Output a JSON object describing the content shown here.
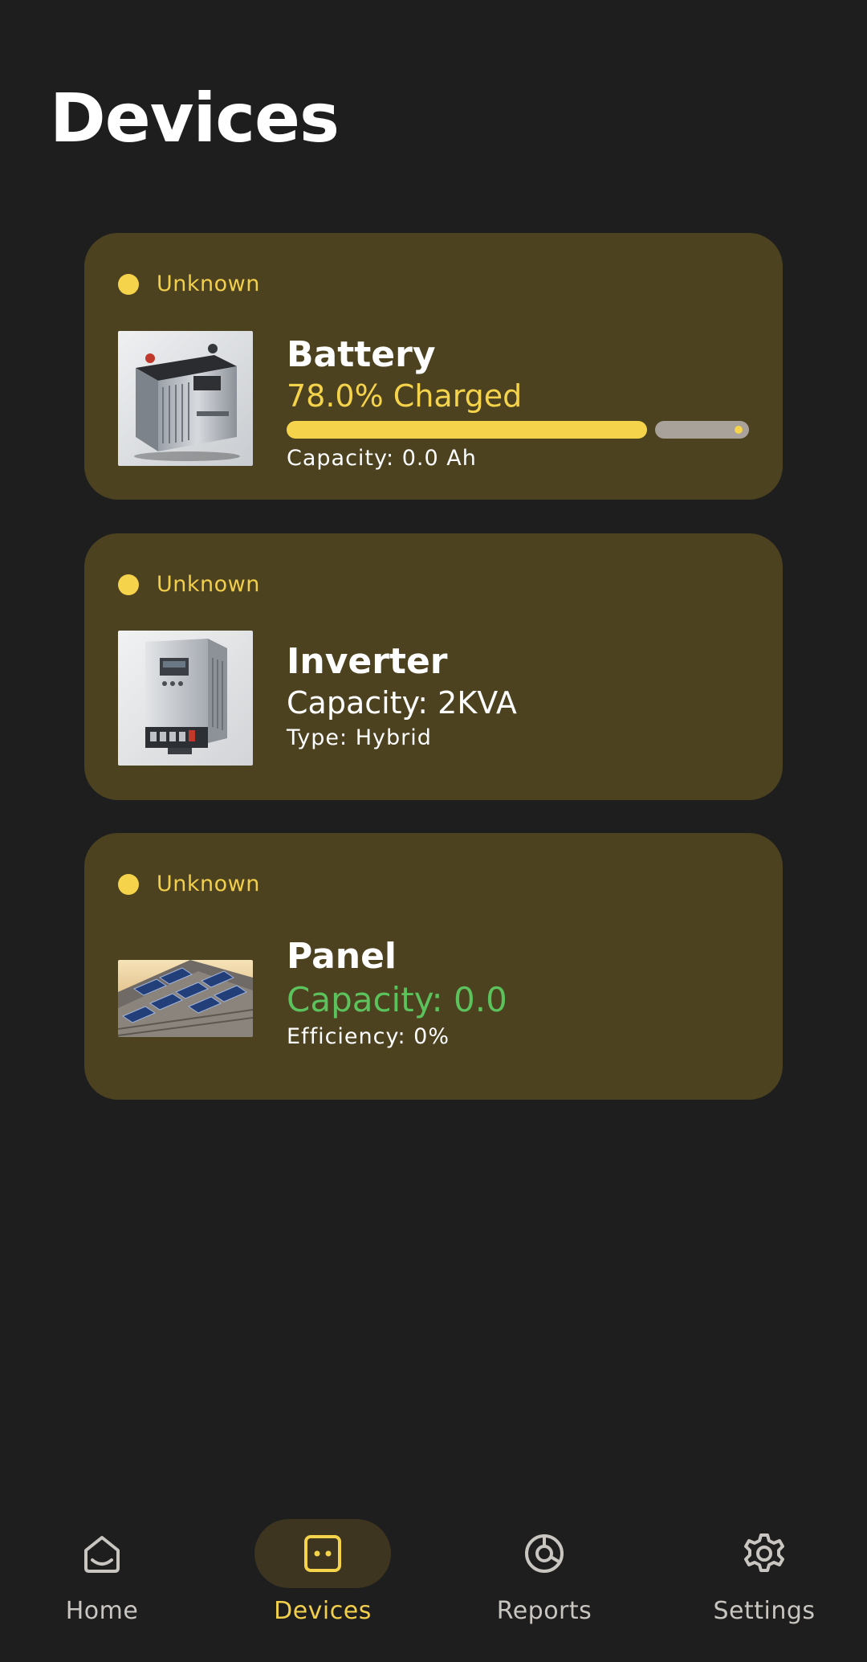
{
  "header": {
    "title": "Devices"
  },
  "devices": [
    {
      "status": "Unknown",
      "name": "Battery",
      "main": "78.0% Charged",
      "main_color": "#f5d34a",
      "charge_fraction": 0.78,
      "sub": "Capacity: 0.0 Ah"
    },
    {
      "status": "Unknown",
      "name": "Inverter",
      "main": "Capacity: 2KVA",
      "main_color": "#ffffff",
      "sub": "Type: Hybrid"
    },
    {
      "status": "Unknown",
      "name": "Panel",
      "main": "Capacity: 0.0",
      "main_color": "#5cc25c",
      "sub": "Efficiency: 0%"
    }
  ],
  "nav": {
    "items": [
      {
        "label": "Home",
        "icon": "home-icon",
        "active": false
      },
      {
        "label": "Devices",
        "icon": "devices-icon",
        "active": true
      },
      {
        "label": "Reports",
        "icon": "reports-icon",
        "active": false
      },
      {
        "label": "Settings",
        "icon": "settings-icon",
        "active": false
      }
    ]
  },
  "colors": {
    "background": "#1f1e1e",
    "card": "#4c4220",
    "accent": "#f5d34a",
    "panel_capacity": "#5cc25c"
  }
}
